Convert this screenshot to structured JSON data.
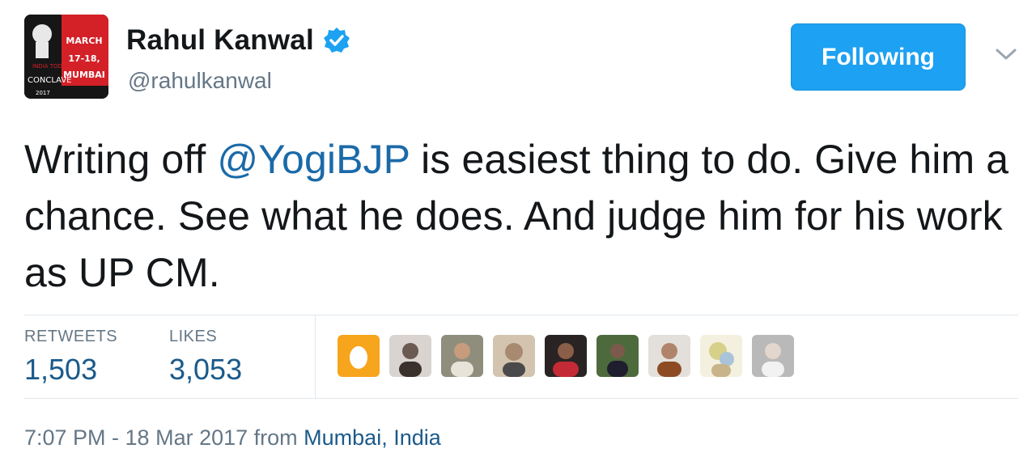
{
  "user": {
    "display_name": "Rahul Kanwal",
    "handle": "@rahulkanwal",
    "verified": true,
    "avatar": {
      "icon": "conclave-logo-avatar",
      "lines": [
        "MARCH",
        "17-18,",
        "MUMBAI"
      ],
      "brand": "INDIA TODAY",
      "event": "CONCLAVE",
      "year": "2017"
    }
  },
  "follow_button": {
    "label": "Following",
    "color": "#1da1f2"
  },
  "menu": {
    "icon": "chevron-down-icon"
  },
  "tweet": {
    "text_before": "Writing off ",
    "mention": "@YogiBJP",
    "text_after": " is easiest thing to do. Give him a chance. See what he does. And judge him for his work as UP CM."
  },
  "stats": {
    "retweets": {
      "label": "RETWEETS",
      "value": "1,503"
    },
    "likes": {
      "label": "LIKES",
      "value": "3,053"
    }
  },
  "likers": [
    {
      "icon": "egg-avatar",
      "color": "#f7a51d"
    },
    {
      "icon": "user-avatar",
      "color": "#6b5a52"
    },
    {
      "icon": "user-avatar",
      "color": "#8f8d7c"
    },
    {
      "icon": "user-avatar",
      "color": "#a88a70"
    },
    {
      "icon": "user-avatar",
      "color": "#c42a35"
    },
    {
      "icon": "user-avatar",
      "color": "#4d6a3c"
    },
    {
      "icon": "user-avatar",
      "color": "#b0846a"
    },
    {
      "icon": "user-avatar",
      "color": "#d6d08a"
    },
    {
      "icon": "user-avatar",
      "color": "#b9b9b9"
    }
  ],
  "footer": {
    "timestamp": "7:07 PM - 18 Mar 2017",
    "from": " from ",
    "place": "Mumbai, India"
  },
  "colors": {
    "link": "#1b6aa8",
    "secondary_text": "#657786",
    "primary_text": "#14171a",
    "divider": "#e1e8ed"
  }
}
